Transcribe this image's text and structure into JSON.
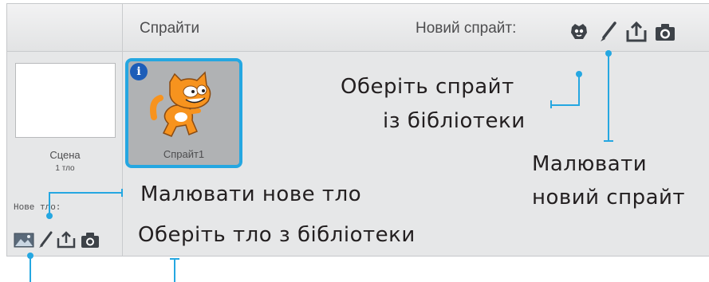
{
  "header": {
    "title": "Спрайти",
    "new_sprite_label": "Новий спрайт:",
    "tools": [
      "sprite-library-icon",
      "paintbrush-icon",
      "upload-icon",
      "camera-icon"
    ]
  },
  "stage": {
    "name": "Сцена",
    "backdrop_count": "1 тло",
    "new_backdrop_label": "Нове тло:",
    "tools": [
      "backdrop-library-icon",
      "paintbrush-icon",
      "upload-icon",
      "camera-icon"
    ]
  },
  "sprites": [
    {
      "name": "Спрайт1",
      "selected": true
    }
  ],
  "annotations": {
    "choose_sprite_line1": "Оберіть спрайт",
    "choose_sprite_line2": "із бібліотеки",
    "paint_sprite_line1": "Малювати",
    "paint_sprite_line2": "новий спрайт",
    "paint_backdrop": "Малювати нове тло",
    "choose_backdrop": "Оберіть тло з бібліотеки"
  },
  "colors": {
    "accent": "#25a7e1",
    "panel": "#e6e7e8",
    "info_badge": "#1d5db8",
    "cat_orange": "#f7931e"
  }
}
